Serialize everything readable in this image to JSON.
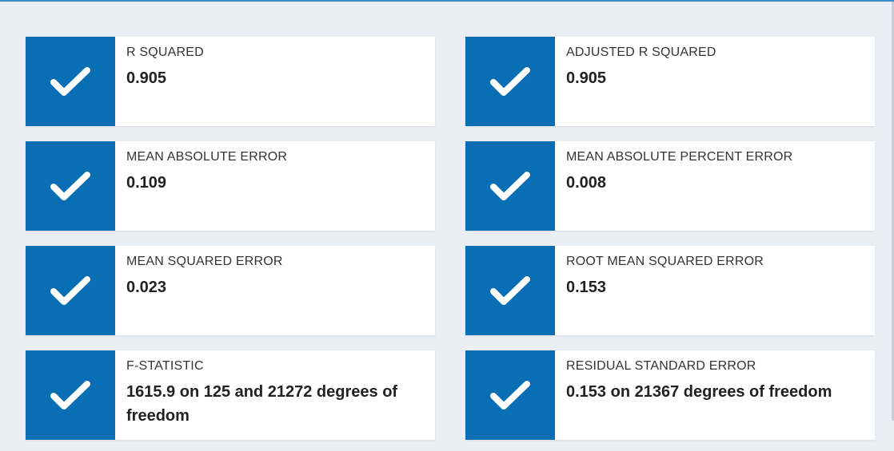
{
  "metrics": [
    {
      "label": "R SQUARED",
      "value": "0.905",
      "icon": "check-icon"
    },
    {
      "label": "ADJUSTED R SQUARED",
      "value": "0.905",
      "icon": "check-icon"
    },
    {
      "label": "MEAN ABSOLUTE ERROR",
      "value": "0.109",
      "icon": "check-icon"
    },
    {
      "label": "MEAN ABSOLUTE PERCENT ERROR",
      "value": "0.008",
      "icon": "check-icon"
    },
    {
      "label": "MEAN SQUARED ERROR",
      "value": "0.023",
      "icon": "check-icon"
    },
    {
      "label": "ROOT MEAN SQUARED ERROR",
      "value": "0.153",
      "icon": "check-icon"
    },
    {
      "label": "F-STATISTIC",
      "value": "1615.9 on 125 and 21272 degrees of freedom",
      "icon": "check-icon"
    },
    {
      "label": "RESIDUAL STANDARD ERROR",
      "value": "0.153 on 21367 degrees of freedom",
      "icon": "check-icon"
    }
  ],
  "colors": {
    "accent": "#0a6eb4",
    "background": "#ebeff5",
    "card": "#ffffff",
    "top_border": "#3a8cc7"
  }
}
